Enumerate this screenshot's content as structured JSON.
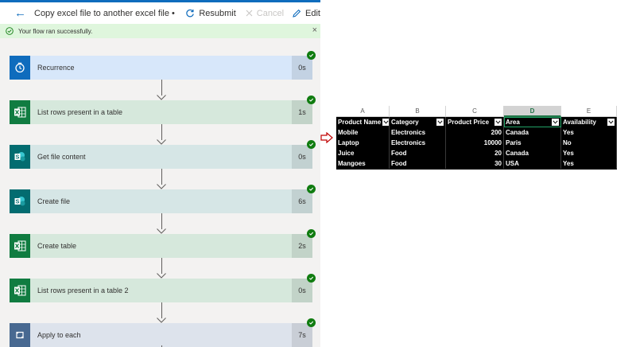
{
  "header": {
    "title": "Copy excel file to another excel file • Ran at...",
    "resubmit_label": "Resubmit",
    "cancel_label": "Cancel",
    "edit_label": "Edit"
  },
  "banner": {
    "message": "Your flow ran successfully."
  },
  "colors": {
    "accent": "#0f6cbd",
    "success": "#107c10",
    "banner_bg": "#dff6dd",
    "schedule_icon": "#0f6cbd",
    "excel_icon": "#107c41",
    "sharepoint_icon": "#036c70",
    "loop_icon": "#486991"
  },
  "steps": [
    {
      "label": "Recurrence",
      "duration": "0s",
      "icon": "clock-icon",
      "status": "succeeded"
    },
    {
      "label": "List rows present in a table",
      "duration": "1s",
      "icon": "excel-icon",
      "status": "succeeded"
    },
    {
      "label": "Get file content",
      "duration": "0s",
      "icon": "sharepoint-icon",
      "status": "succeeded"
    },
    {
      "label": "Create file",
      "duration": "6s",
      "icon": "sharepoint-icon",
      "status": "succeeded"
    },
    {
      "label": "Create table",
      "duration": "2s",
      "icon": "excel-icon",
      "status": "succeeded"
    },
    {
      "label": "List rows present in a table 2",
      "duration": "0s",
      "icon": "excel-icon",
      "status": "succeeded"
    },
    {
      "label": "Apply to each",
      "duration": "7s",
      "icon": "loop-icon",
      "status": "succeeded"
    }
  ],
  "spreadsheet": {
    "column_letters": [
      "A",
      "B",
      "C",
      "D",
      "E"
    ],
    "selected_column": "D",
    "headers": [
      "Product Name",
      "Category",
      "Product Price",
      "Area",
      "Availability"
    ],
    "rows": [
      [
        "Mobile",
        "Electronics",
        "200",
        "Canada",
        "Yes"
      ],
      [
        "Laptop",
        "Electronics",
        "10000",
        "Paris",
        "No"
      ],
      [
        "Juice",
        "Food",
        "20",
        "Canada",
        "Yes"
      ],
      [
        "Mangoes",
        "Food",
        "30",
        "USA",
        "Yes"
      ]
    ]
  }
}
